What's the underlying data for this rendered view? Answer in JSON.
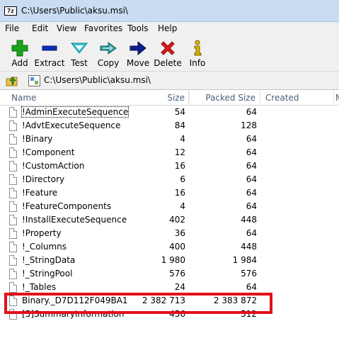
{
  "window": {
    "title": "C:\\Users\\Public\\aksu.msi\\",
    "icon": "7zip-app-icon"
  },
  "menu": [
    "File",
    "Edit",
    "View",
    "Favorites",
    "Tools",
    "Help"
  ],
  "toolbar": [
    {
      "label": "Add",
      "icon": "add-icon",
      "color": "#19a319"
    },
    {
      "label": "Extract",
      "icon": "extract-icon",
      "color": "#0b2fb8"
    },
    {
      "label": "Test",
      "icon": "test-icon",
      "color": "#31c7d8"
    },
    {
      "label": "Copy",
      "icon": "copy-icon",
      "color": "#2f9c9a"
    },
    {
      "label": "Move",
      "icon": "move-icon",
      "color": "#0d1f8c"
    },
    {
      "label": "Delete",
      "icon": "delete-icon",
      "color": "#e01919"
    },
    {
      "label": "Info",
      "icon": "info-icon",
      "color": "#d9b400"
    }
  ],
  "address": {
    "path": "C:\\Users\\Public\\aksu.msi\\"
  },
  "columns": {
    "name": "Name",
    "size": "Size",
    "packed_size": "Packed Size",
    "created": "Created",
    "more": "M"
  },
  "files": [
    {
      "name": "!AdminExecuteSequence",
      "size": "54",
      "packed": "64"
    },
    {
      "name": "!AdvtExecuteSequence",
      "size": "84",
      "packed": "128"
    },
    {
      "name": "!Binary",
      "size": "4",
      "packed": "64"
    },
    {
      "name": "!Component",
      "size": "12",
      "packed": "64"
    },
    {
      "name": "!CustomAction",
      "size": "16",
      "packed": "64"
    },
    {
      "name": "!Directory",
      "size": "6",
      "packed": "64"
    },
    {
      "name": "!Feature",
      "size": "16",
      "packed": "64"
    },
    {
      "name": "!FeatureComponents",
      "size": "4",
      "packed": "64"
    },
    {
      "name": "!InstallExecuteSequence",
      "size": "402",
      "packed": "448"
    },
    {
      "name": "!Property",
      "size": "36",
      "packed": "64"
    },
    {
      "name": "!_Columns",
      "size": "400",
      "packed": "448"
    },
    {
      "name": "!_StringData",
      "size": "1 980",
      "packed": "1 984"
    },
    {
      "name": "!_StringPool",
      "size": "576",
      "packed": "576"
    },
    {
      "name": "!_Tables",
      "size": "24",
      "packed": "64"
    },
    {
      "name": "Binary._D7D112F049BA1...",
      "size": "2 382 713",
      "packed": "2 383 872"
    },
    {
      "name": "[5]SummaryInformation",
      "size": "456",
      "packed": "512"
    }
  ],
  "highlight_color": "#e2101b"
}
